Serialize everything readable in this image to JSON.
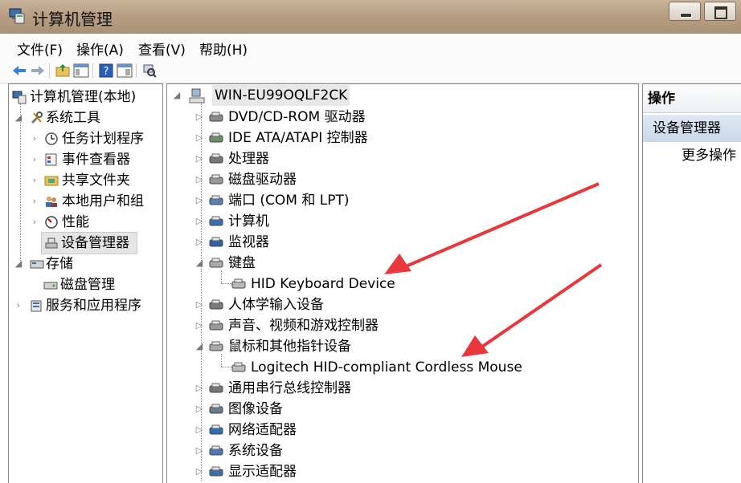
{
  "window": {
    "title": "计算机管理"
  },
  "menu": [
    "文件(F)",
    "操作(A)",
    "查看(V)",
    "帮助(H)"
  ],
  "left_tree": {
    "root": "计算机管理(本地)",
    "items": [
      {
        "label": "系统工具",
        "icon": "tools-icon"
      },
      {
        "label": "任务计划程序",
        "icon": "clock-icon"
      },
      {
        "label": "事件查看器",
        "icon": "event-viewer-icon"
      },
      {
        "label": "共享文件夹",
        "icon": "shared-folder-icon"
      },
      {
        "label": "本地用户和组",
        "icon": "users-icon"
      },
      {
        "label": "性能",
        "icon": "performance-icon"
      },
      {
        "label": "设备管理器",
        "icon": "device-manager-icon"
      },
      {
        "label": "存储",
        "icon": "storage-icon"
      },
      {
        "label": "磁盘管理",
        "icon": "disk-management-icon"
      },
      {
        "label": "服务和应用程序",
        "icon": "services-icon"
      }
    ]
  },
  "device_tree": {
    "computer": "WIN-EU99OQLF2CK",
    "categories": [
      {
        "label": "DVD/CD-ROM 驱动器",
        "icon": "dvd-drive-icon"
      },
      {
        "label": "IDE ATA/ATAPI 控制器",
        "icon": "ide-controller-icon"
      },
      {
        "label": "处理器",
        "icon": "processor-icon"
      },
      {
        "label": "磁盘驱动器",
        "icon": "disk-drive-icon"
      },
      {
        "label": "端口 (COM 和 LPT)",
        "icon": "port-icon"
      },
      {
        "label": "计算机",
        "icon": "computer-icon"
      },
      {
        "label": "监视器",
        "icon": "monitor-icon"
      },
      {
        "label": "键盘",
        "icon": "keyboard-icon"
      },
      {
        "label": "HID Keyboard Device",
        "icon": "keyboard-device-icon"
      },
      {
        "label": "人体学输入设备",
        "icon": "hid-icon"
      },
      {
        "label": "声音、视频和游戏控制器",
        "icon": "sound-icon"
      },
      {
        "label": "鼠标和其他指针设备",
        "icon": "mouse-icon"
      },
      {
        "label": "Logitech HID-compliant Cordless Mouse",
        "icon": "mouse-device-icon"
      },
      {
        "label": "通用串行总线控制器",
        "icon": "usb-icon"
      },
      {
        "label": "图像设备",
        "icon": "imaging-icon"
      },
      {
        "label": "网络适配器",
        "icon": "network-icon"
      },
      {
        "label": "系统设备",
        "icon": "system-device-icon"
      },
      {
        "label": "显示适配器",
        "icon": "display-adapter-icon"
      }
    ]
  },
  "actions": {
    "header": "操作",
    "selected": "设备管理器",
    "more": "更多操作"
  },
  "colors": {
    "arrow": "#e8383d",
    "selection": "#c9d8ea"
  }
}
